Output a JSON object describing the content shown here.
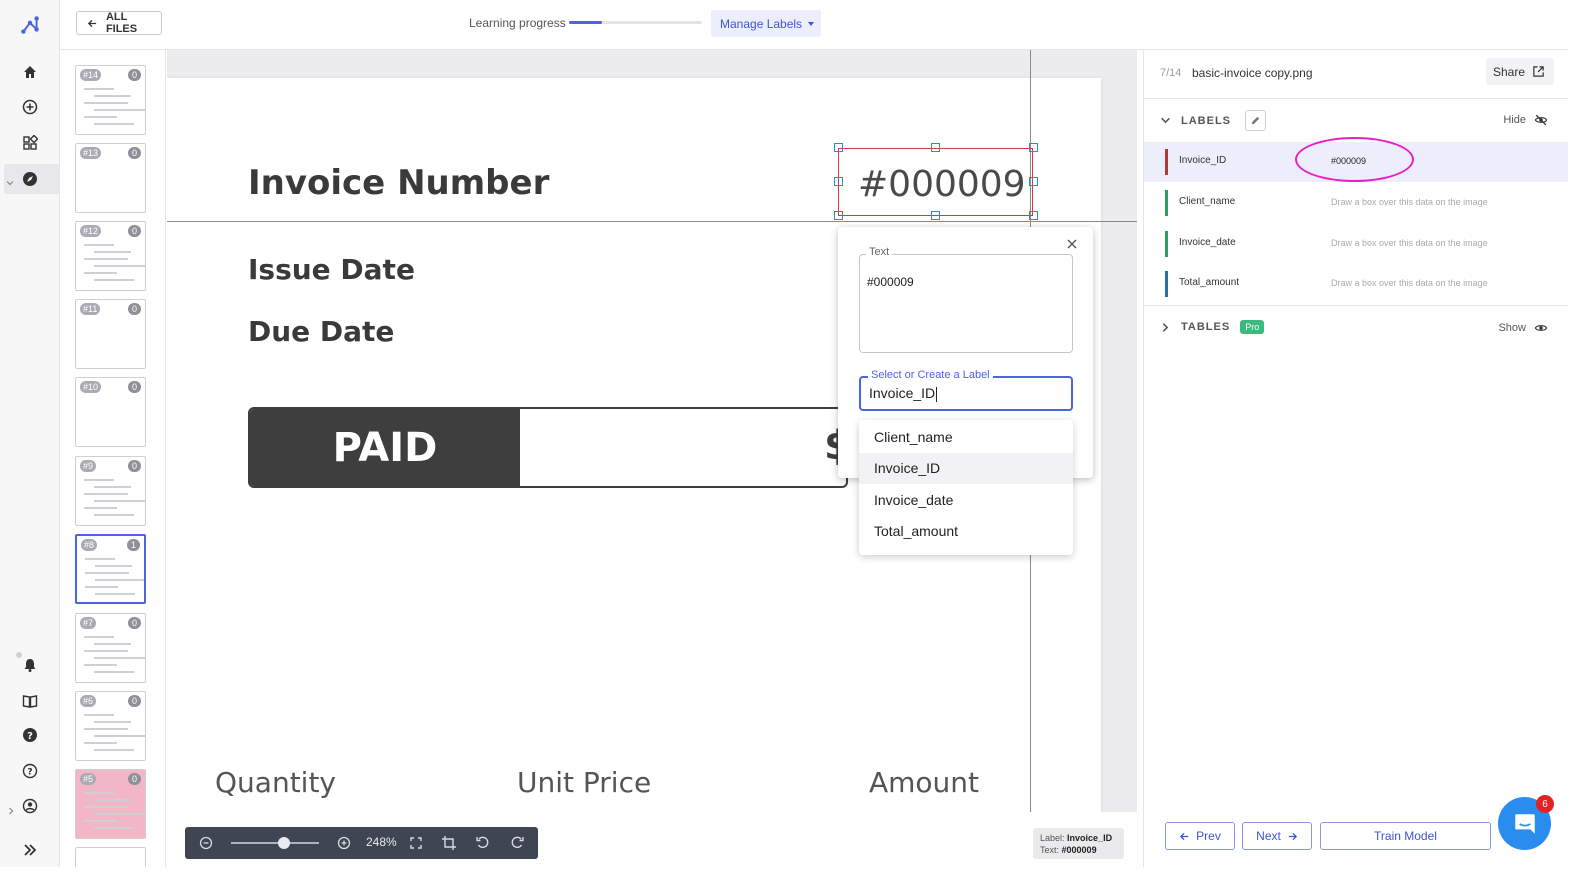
{
  "topbar": {
    "all_files": "ALL FILES",
    "learning_progress_label": "Learning progress",
    "learning_progress": 0.25,
    "manage_labels": "Manage Labels"
  },
  "thumbnails": [
    {
      "num": "#14",
      "count": "0"
    },
    {
      "num": "#13",
      "count": "0"
    },
    {
      "num": "#12",
      "count": "0"
    },
    {
      "num": "#11",
      "count": "0"
    },
    {
      "num": "#10",
      "count": "0"
    },
    {
      "num": "#9",
      "count": "0"
    },
    {
      "num": "#8",
      "count": "1"
    },
    {
      "num": "#7",
      "count": "0"
    },
    {
      "num": "#6",
      "count": "0"
    },
    {
      "num": "#5",
      "count": "0"
    }
  ],
  "document": {
    "invoice_number_label": "Invoice Number",
    "invoice_number_value": "#000009",
    "issue_date": "Issue Date",
    "due_date": "Due Date",
    "paid": "PAID",
    "dollar": "$",
    "col_quantity": "Quantity",
    "col_unit_price": "Unit Price",
    "col_amount": "Amount"
  },
  "popup": {
    "text_legend": "Text",
    "text_value": "#000009",
    "label_legend": "Select or Create a Label",
    "label_value": "Invoice_ID",
    "options": [
      "Client_name",
      "Invoice_ID",
      "Invoice_date",
      "Total_amount"
    ],
    "active_option": "Invoice_ID"
  },
  "zoom": {
    "percent": "248%",
    "level": 0.6
  },
  "status": {
    "label_key": "Label:",
    "label_value": "Invoice_ID",
    "text_key": "Text:",
    "text_value": "#000009"
  },
  "panel": {
    "file_count": "7/14",
    "file_name": "basic-invoice copy.png",
    "share": "Share",
    "labels_header": "LABELS",
    "hide": "Hide",
    "labels": [
      {
        "name": "Invoice_ID",
        "value": "#000009",
        "color": "#b03a3a"
      },
      {
        "name": "Client_name",
        "value": "Draw a box over this data on the image",
        "color": "#2f9e5b"
      },
      {
        "name": "Invoice_date",
        "value": "Draw a box over this data on the image",
        "color": "#2f9e5b"
      },
      {
        "name": "Total_amount",
        "value": "Draw a box over this data on the image",
        "color": "#2a6fa8"
      }
    ],
    "tables_header": "TABLES",
    "pro": "Pro",
    "show": "Show",
    "prev": "Prev",
    "next": "Next",
    "train_model": "Train Model",
    "chat_badge": "6"
  },
  "colors": {
    "accent": "#4c63e6",
    "highlight": "#e61fc9"
  }
}
